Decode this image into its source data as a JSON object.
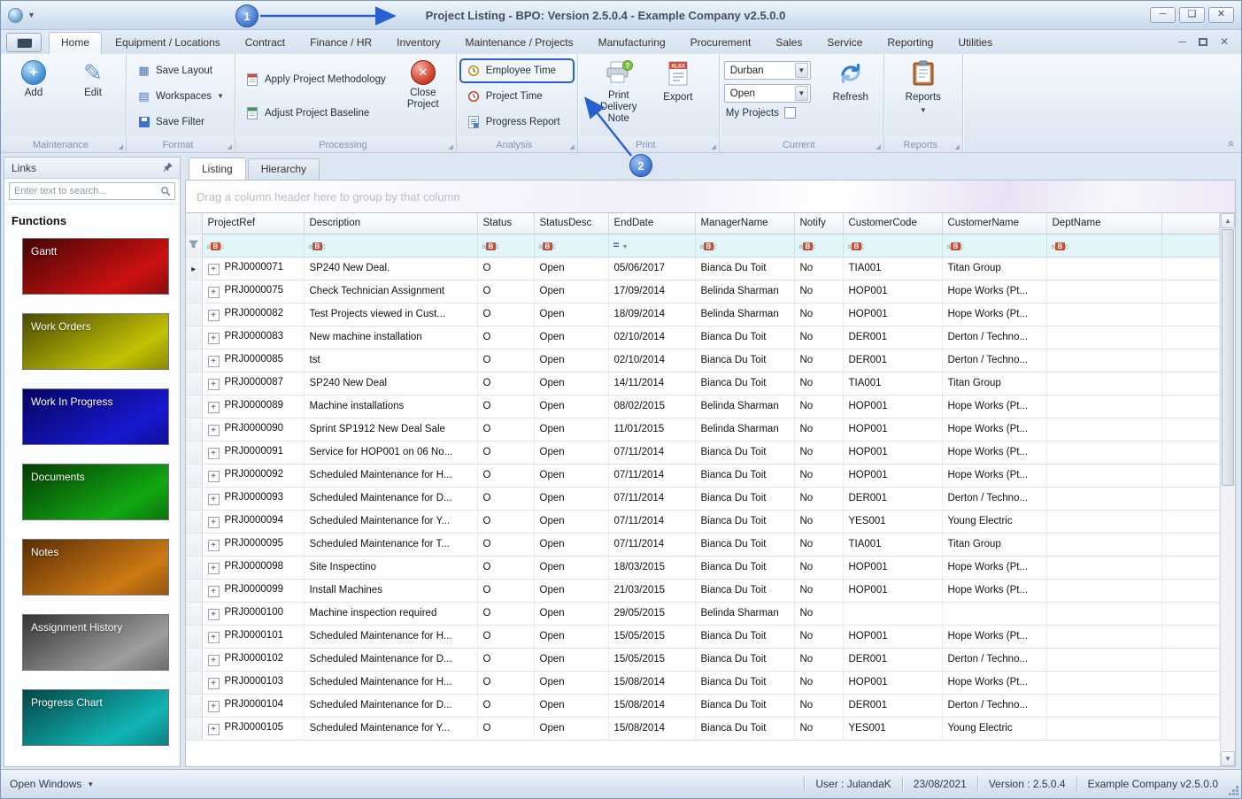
{
  "titlebar": {
    "title_highlight": "Project Listing",
    "title_rest": " - BPO: Version 2.5.0.4 - Example Company v2.5.0.0"
  },
  "ribbon": {
    "tabs": [
      {
        "label": "Home",
        "active": true
      },
      {
        "label": "Equipment / Locations",
        "active": false
      },
      {
        "label": "Contract",
        "active": false
      },
      {
        "label": "Finance / HR",
        "active": false
      },
      {
        "label": "Inventory",
        "active": false
      },
      {
        "label": "Maintenance / Projects",
        "active": false
      },
      {
        "label": "Manufacturing",
        "active": false
      },
      {
        "label": "Procurement",
        "active": false
      },
      {
        "label": "Sales",
        "active": false
      },
      {
        "label": "Service",
        "active": false
      },
      {
        "label": "Reporting",
        "active": false
      },
      {
        "label": "Utilities",
        "active": false
      }
    ],
    "groups": {
      "maintenance": {
        "label": "Maintenance",
        "add": "Add",
        "edit": "Edit"
      },
      "format": {
        "label": "Format",
        "save_layout": "Save Layout",
        "workspaces": "Workspaces",
        "save_filter": "Save Filter"
      },
      "processing": {
        "label": "Processing",
        "apply_methodology": "Apply Project Methodology",
        "adjust_baseline": "Adjust Project Baseline",
        "close_project": "Close Project"
      },
      "analysis": {
        "label": "Analysis",
        "employee_time": "Employee Time",
        "project_time": "Project Time",
        "progress_report": "Progress Report"
      },
      "print": {
        "label": "Print",
        "print_delivery_note": "Print Delivery Note",
        "export": "Export"
      },
      "current": {
        "label": "Current",
        "site_value": "Durban",
        "status_value": "Open",
        "my_projects": "My Projects",
        "refresh": "Refresh"
      },
      "reports": {
        "label": "Reports",
        "button": "Reports"
      }
    }
  },
  "sidebar": {
    "header": "Links",
    "search_placeholder": "Enter text to search...",
    "functions_heading": "Functions",
    "tiles": [
      {
        "label": "Gantt",
        "color_dark": "#450505",
        "color_bright": "#cc1111"
      },
      {
        "label": "Work Orders",
        "color_dark": "#4a4a05",
        "color_bright": "#c2c205"
      },
      {
        "label": "Work In Progress",
        "color_dark": "#050560",
        "color_bright": "#1818cf"
      },
      {
        "label": "Documents",
        "color_dark": "#053c05",
        "color_bright": "#12a812"
      },
      {
        "label": "Notes",
        "color_dark": "#5a2d05",
        "color_bright": "#cc7a14"
      },
      {
        "label": "Assignment History",
        "color_dark": "#333333",
        "color_bright": "#9e9e9e"
      },
      {
        "label": "Progress Chart",
        "color_dark": "#054545",
        "color_bright": "#12b5b5"
      }
    ]
  },
  "content": {
    "tabs": [
      {
        "label": "Listing",
        "active": true
      },
      {
        "label": "Hierarchy",
        "active": false
      }
    ],
    "group_hint": "Drag a column header here to group by that column",
    "grid": {
      "columns": [
        "ProjectRef",
        "Description",
        "Status",
        "StatusDesc",
        "EndDate",
        "ManagerName",
        "Notify",
        "CustomerCode",
        "CustomerName",
        "DeptName"
      ],
      "rows": [
        [
          "PRJ0000071",
          "SP240 New Deal.",
          "O",
          "Open",
          "05/06/2017",
          "Bianca Du Toit",
          "No",
          "TIA001",
          "Titan Group",
          ""
        ],
        [
          "PRJ0000075",
          "Check Technician Assignment",
          "O",
          "Open",
          "17/09/2014",
          "Belinda Sharman",
          "No",
          "HOP001",
          "Hope Works (Pt...",
          ""
        ],
        [
          "PRJ0000082",
          "Test Projects viewed in Cust...",
          "O",
          "Open",
          "18/09/2014",
          "Belinda Sharman",
          "No",
          "HOP001",
          "Hope Works (Pt...",
          ""
        ],
        [
          "PRJ0000083",
          "New machine installation",
          "O",
          "Open",
          "02/10/2014",
          "Bianca Du Toit",
          "No",
          "DER001",
          "Derton / Techno...",
          ""
        ],
        [
          "PRJ0000085",
          "tst",
          "O",
          "Open",
          "02/10/2014",
          "Bianca Du Toit",
          "No",
          "DER001",
          "Derton / Techno...",
          ""
        ],
        [
          "PRJ0000087",
          "SP240 New Deal",
          "O",
          "Open",
          "14/11/2014",
          "Bianca Du Toit",
          "No",
          "TIA001",
          "Titan Group",
          ""
        ],
        [
          "PRJ0000089",
          "Machine installations",
          "O",
          "Open",
          "08/02/2015",
          "Belinda Sharman",
          "No",
          "HOP001",
          "Hope Works (Pt...",
          ""
        ],
        [
          "PRJ0000090",
          "Sprint SP1912 New Deal Sale",
          "O",
          "Open",
          "11/01/2015",
          "Belinda Sharman",
          "No",
          "HOP001",
          "Hope Works (Pt...",
          ""
        ],
        [
          "PRJ0000091",
          "Service for HOP001 on 06 No...",
          "O",
          "Open",
          "07/11/2014",
          "Bianca Du Toit",
          "No",
          "HOP001",
          "Hope Works (Pt...",
          ""
        ],
        [
          "PRJ0000092",
          "Scheduled Maintenance for H...",
          "O",
          "Open",
          "07/11/2014",
          "Bianca Du Toit",
          "No",
          "HOP001",
          "Hope Works (Pt...",
          ""
        ],
        [
          "PRJ0000093",
          "Scheduled Maintenance for D...",
          "O",
          "Open",
          "07/11/2014",
          "Bianca Du Toit",
          "No",
          "DER001",
          "Derton / Techno...",
          ""
        ],
        [
          "PRJ0000094",
          "Scheduled Maintenance for Y...",
          "O",
          "Open",
          "07/11/2014",
          "Bianca Du Toit",
          "No",
          "YES001",
          "Young Electric",
          ""
        ],
        [
          "PRJ0000095",
          "Scheduled Maintenance for T...",
          "O",
          "Open",
          "07/11/2014",
          "Bianca Du Toit",
          "No",
          "TIA001",
          "Titan Group",
          ""
        ],
        [
          "PRJ0000098",
          "Site Inspectino",
          "O",
          "Open",
          "18/03/2015",
          "Bianca Du Toit",
          "No",
          "HOP001",
          "Hope Works (Pt...",
          ""
        ],
        [
          "PRJ0000099",
          "Install Machines",
          "O",
          "Open",
          "21/03/2015",
          "Bianca Du Toit",
          "No",
          "HOP001",
          "Hope Works (Pt...",
          ""
        ],
        [
          "PRJ0000100",
          "Machine inspection required",
          "O",
          "Open",
          "29/05/2015",
          "Belinda Sharman",
          "No",
          "",
          "",
          ""
        ],
        [
          "PRJ0000101",
          "Scheduled Maintenance for H...",
          "O",
          "Open",
          "15/05/2015",
          "Bianca Du Toit",
          "No",
          "HOP001",
          "Hope Works (Pt...",
          ""
        ],
        [
          "PRJ0000102",
          "Scheduled Maintenance for D...",
          "O",
          "Open",
          "15/05/2015",
          "Bianca Du Toit",
          "No",
          "DER001",
          "Derton / Techno...",
          ""
        ],
        [
          "PRJ0000103",
          "Scheduled Maintenance for H...",
          "O",
          "Open",
          "15/08/2014",
          "Bianca Du Toit",
          "No",
          "HOP001",
          "Hope Works (Pt...",
          ""
        ],
        [
          "PRJ0000104",
          "Scheduled Maintenance for D...",
          "O",
          "Open",
          "15/08/2014",
          "Bianca Du Toit",
          "No",
          "DER001",
          "Derton / Techno...",
          ""
        ],
        [
          "PRJ0000105",
          "Scheduled Maintenance for Y...",
          "O",
          "Open",
          "15/08/2014",
          "Bianca Du Toit",
          "No",
          "YES001",
          "Young Electric",
          ""
        ]
      ]
    }
  },
  "statusbar": {
    "open_windows": "Open Windows",
    "user": "User : JulandaK",
    "date": "23/08/2021",
    "version": "Version : 2.5.0.4",
    "company": "Example Company v2.5.0.0"
  },
  "annotations": {
    "badge1": "1",
    "badge2": "2",
    "accent_color": "#2a5fd0"
  }
}
